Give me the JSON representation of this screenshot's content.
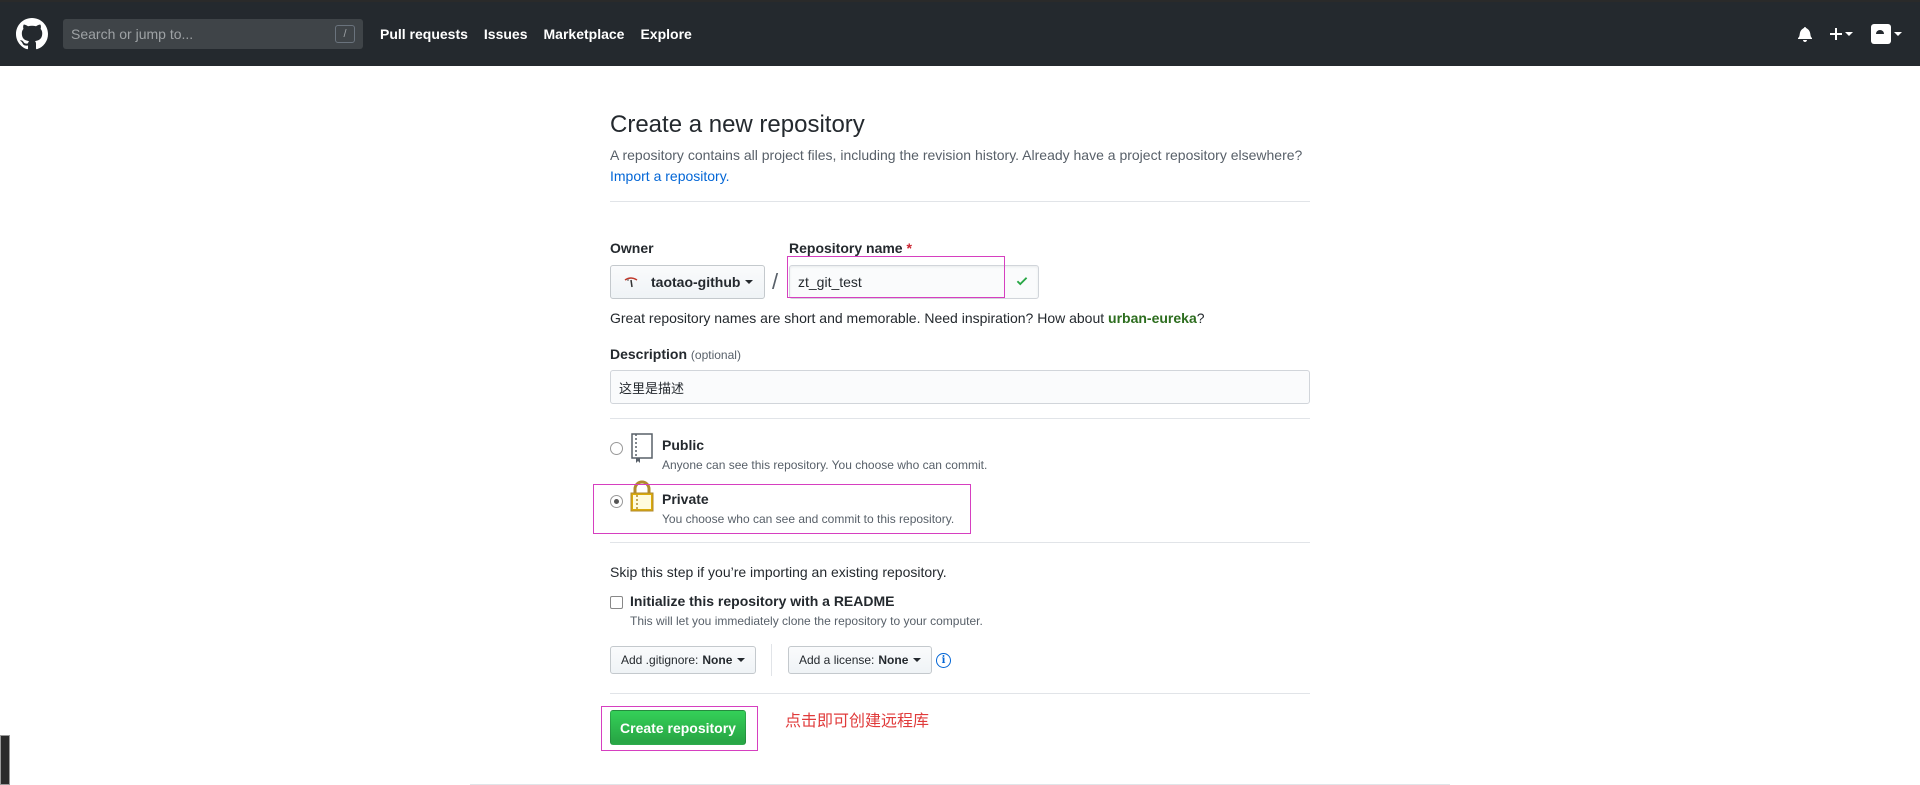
{
  "header": {
    "search_placeholder": "Search or jump to...",
    "search_shortcut": "/",
    "nav": [
      "Pull requests",
      "Issues",
      "Marketplace",
      "Explore"
    ]
  },
  "page": {
    "title": "Create a new repository",
    "description": "A repository contains all project files, including the revision history. Already have a project repository elsewhere?",
    "import_link": "Import a repository."
  },
  "form": {
    "owner_label": "Owner",
    "owner_value": "taotao-github",
    "repo_name_label": "Repository name",
    "required_mark": "*",
    "repo_name_value": "zt_git_test",
    "hint_text": "Great repository names are short and memorable. Need inspiration? How about",
    "suggestion": "urban-eureka",
    "hint_end": "?",
    "description_label": "Description",
    "description_optional": "(optional)",
    "description_value": "这里是描述",
    "visibility": {
      "public_title": "Public",
      "public_note": "Anyone can see this repository. You choose who can commit.",
      "private_title": "Private",
      "private_note": "You choose who can see and commit to this repository.",
      "selected": "Private"
    },
    "skip_text": "Skip this step if you’re importing an existing repository.",
    "readme_label": "Initialize this repository with a README",
    "readme_note": "This will let you immediately clone the repository to your computer.",
    "readme_checked": false,
    "gitignore_label": "Add .gitignore:",
    "gitignore_value": "None",
    "license_label": "Add a license:",
    "license_value": "None",
    "submit_label": "Create repository"
  },
  "annotation": "点击即可创建远程库",
  "colors": {
    "header_bg": "#24292e",
    "primary_green": "#28a745",
    "link_blue": "#0366d6",
    "highlight_magenta": "#d63fc0",
    "annotation_red": "#e03b3b"
  }
}
